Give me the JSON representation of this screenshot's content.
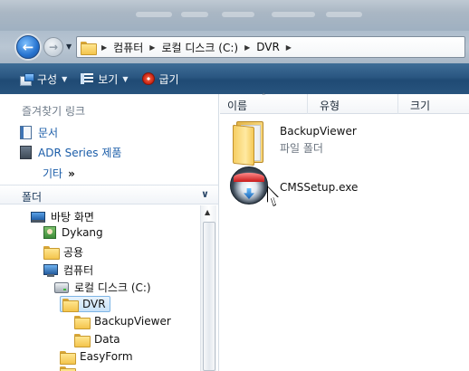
{
  "address_bar": {
    "crumbs": [
      "컴퓨터",
      "로컬 디스크 (C:)",
      "DVR"
    ]
  },
  "toolbar": {
    "organize_label": "구성",
    "views_label": "보기",
    "burn_label": "굽기"
  },
  "favorites": {
    "title": "즐겨찾기 링크",
    "items": [
      {
        "label": "문서",
        "icon": "document-icon"
      },
      {
        "label": "ADR Series 제품",
        "icon": "adr-product-icon"
      }
    ],
    "more_label": "기타",
    "more_glyph": "»"
  },
  "folders_pane": {
    "title": "폴더",
    "tree": [
      {
        "label": "바탕 화면",
        "icon": "desktop-icon"
      },
      {
        "label": "Dykang",
        "icon": "user-icon"
      },
      {
        "label": "공용",
        "icon": "folder-icon"
      },
      {
        "label": "컴퓨터",
        "icon": "computer-icon"
      },
      {
        "label": "로컬 디스크 (C:)",
        "icon": "drive-icon"
      },
      {
        "label": "DVR",
        "icon": "folder-icon",
        "selected": true
      },
      {
        "label": "BackupViewer",
        "icon": "folder-icon"
      },
      {
        "label": "Data",
        "icon": "folder-icon"
      },
      {
        "label": "EasyForm",
        "icon": "folder-icon"
      }
    ]
  },
  "file_list": {
    "columns": [
      "이름",
      "유형",
      "크기"
    ],
    "items": [
      {
        "name": "BackupViewer",
        "type": "파일 폴더",
        "icon": "folder-icon"
      },
      {
        "name": "CMSSetup.exe",
        "type": "",
        "icon": "setup-disc-icon"
      }
    ]
  },
  "colors": {
    "toolbar_bg": "#2a5681",
    "link_text": "#1a5ca8",
    "selection_border": "#7fb6e6"
  }
}
